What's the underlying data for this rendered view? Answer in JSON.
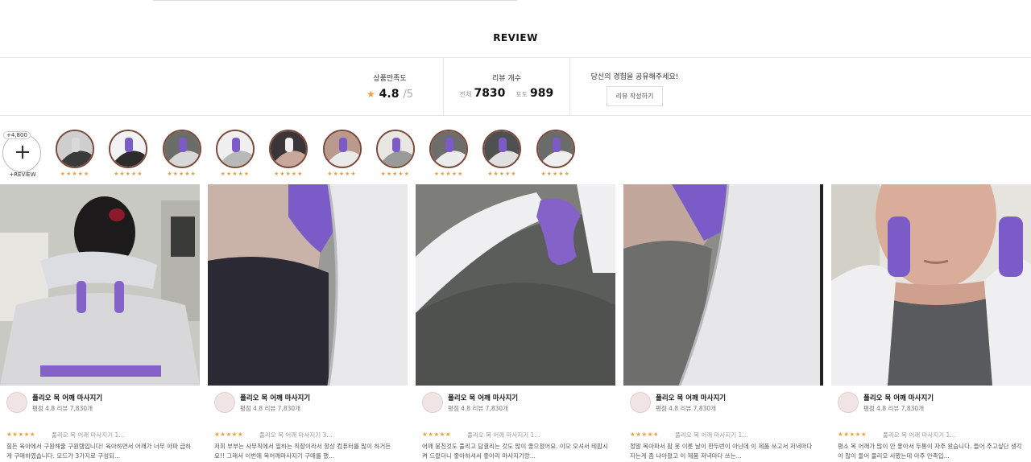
{
  "section": {
    "title": "REVIEW"
  },
  "summary": {
    "satisfaction_label": "상품만족도",
    "rating": "4.8",
    "rating_max": "/5",
    "count_label": "리뷰 개수",
    "total_label": "전체",
    "total_count": "7830",
    "photo_label": "포토",
    "photo_count": "989",
    "share_label": "당신의 경험을 공유해주세요!",
    "write_button": "리뷰 작성하기"
  },
  "thumbs": {
    "add_count": "+4,800",
    "add_label": "+REVIEW",
    "stars": "★★★★★",
    "items": [
      1,
      2,
      3,
      4,
      5,
      6,
      7,
      8,
      9,
      10
    ]
  },
  "colors": {
    "star": "#e8a33d",
    "accent_purple": "#7a5bc7",
    "border": "#e5e5e5"
  },
  "cards": [
    {
      "product": "풀리오 목 어깨 마사지기",
      "meta": "평점 4.8  리뷰 7,830개",
      "stars": "★★★★★",
      "title": "풀리오 목 어깨 마사지기 1...",
      "text": "힘든 육아에서 구원해줄 구원템입니다! 육아하면서 어깨가 너무 아파 급하게 구매하였습니다. 모드가 3가지로 구성되..."
    },
    {
      "product": "풀리오 목 어깨 마사지기",
      "meta": "평점 4.8  리뷰 7,830개",
      "stars": "★★★★★",
      "title": "풀리오 목 어깨 마사지기 3...",
      "text": "저희 부부는 사무직에서 일하는 직장이라서 항상 컴퓨터를 많이 하거든요!! 그래서 이번에 목어깨마사지기 구매를 했..."
    },
    {
      "product": "풀리오 목 어깨 마사지기",
      "meta": "평점 4.8  리뷰 7,830개",
      "stars": "★★★★★",
      "title": "풀리오 목 어깨 마사지기 1...",
      "text": "어깨 뭉친것도 풀리고 담결리는 것도 많이 좋으졌어요. 이모 오셔서 테팝시켜 드렸더니 좋아하셔서 좋아리 마사지기랑..."
    },
    {
      "product": "풀리오 목 어깨 마사지기",
      "meta": "평점 4.8  리뷰 7,830개",
      "stars": "★★★★★",
      "title": "풀리오 목 어깨 마사지기 1...",
      "text": "정말 목아파서 잠 못 이룬 날이 한두번이 아닌데 이 제품 쓰고서 저녁마다 자는게 좀 나아졌고 이 제품 저녁마다 쓰는..."
    },
    {
      "product": "풀리오 목 어깨 마사지기",
      "meta": "평점 4.8  리뷰 7,830개",
      "stars": "★★★★★",
      "title": "풀리오 목 어깨 마사지기 1...",
      "text": "평소 목 어깨가 많이 안 좋아서 두통이 자주 왔습니다. 들어 주고싶단 생각이 많이 들어 풀리오 사봤는데 아주 만족입..."
    }
  ]
}
